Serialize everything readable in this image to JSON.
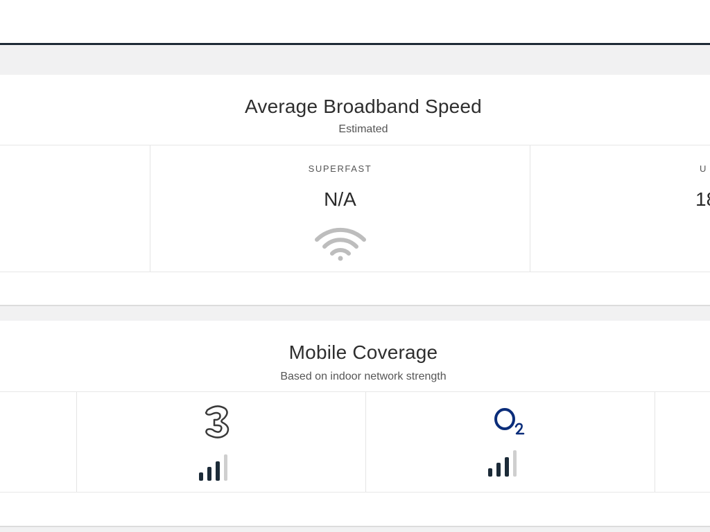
{
  "broadband": {
    "title": "Average Broadband Speed",
    "subtitle": "Estimated",
    "columns": [
      {
        "label": "SUPERFAST",
        "value": "N/A",
        "icon": "wifi-icon"
      },
      {
        "label": "U",
        "value": "18",
        "icon": "wifi-icon"
      }
    ]
  },
  "mobile": {
    "title": "Mobile Coverage",
    "subtitle": "Based on indoor network strength",
    "operators": [
      {
        "logo_text": "3",
        "icon": "three-logo-icon",
        "signal_bars": 3,
        "signal_max": 4
      },
      {
        "logo_text": "O2",
        "icon": "o2-logo-icon",
        "signal_bars": 3,
        "signal_max": 4
      }
    ]
  },
  "colors": {
    "topbar_border": "#1e2a36",
    "signal_on": "#1c2b38",
    "signal_off": "#cfcfcf",
    "wifi_grey": "#bdbdbd",
    "o2_blue": "#0b2d7a"
  }
}
